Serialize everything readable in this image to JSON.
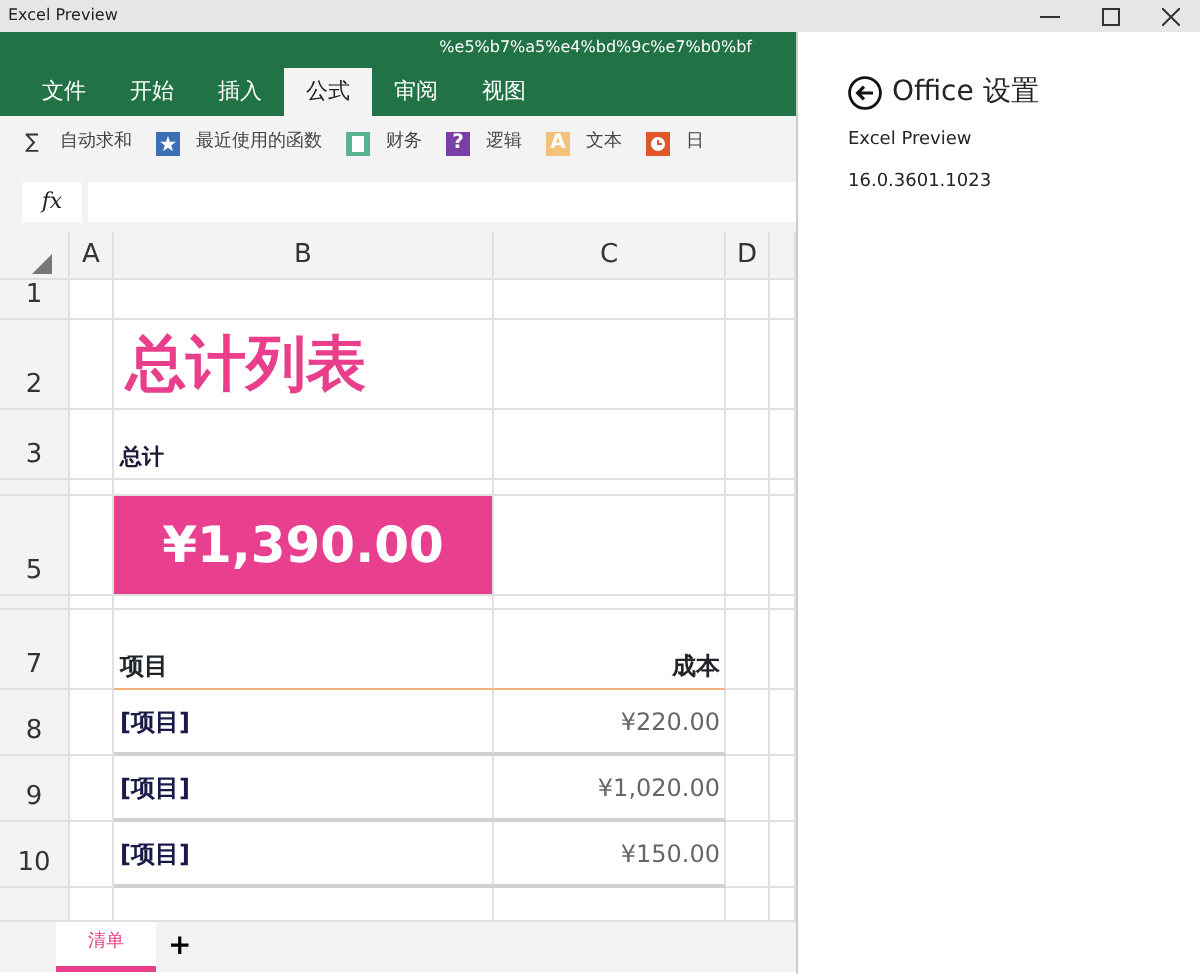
{
  "window": {
    "title": "Excel Preview"
  },
  "document_name": "%e5%b7%a5%e4%bd%9c%e7%b0%bf",
  "tabs": [
    {
      "label": "文件",
      "selected": false
    },
    {
      "label": "开始",
      "selected": false
    },
    {
      "label": "插入",
      "selected": false
    },
    {
      "label": "公式",
      "selected": true
    },
    {
      "label": "审阅",
      "selected": false
    },
    {
      "label": "视图",
      "selected": false
    }
  ],
  "ribbon": [
    {
      "label": "自动求和",
      "kind": "sum",
      "glyph": "∑"
    },
    {
      "label": "最近使用的函数",
      "kind": "star",
      "color": "#3d6fb6"
    },
    {
      "label": "财务",
      "kind": "book",
      "color": "#5ab38e"
    },
    {
      "label": "逻辑",
      "kind": "question",
      "glyph": "?",
      "color": "#7b3fa8"
    },
    {
      "label": "文本",
      "kind": "letter",
      "glyph": "A",
      "color": "#f2c27a"
    },
    {
      "label": "日",
      "kind": "clock",
      "color": "#e0572a"
    }
  ],
  "formula_bar": {
    "label": "fx"
  },
  "columns": [
    "A",
    "B",
    "C",
    "D"
  ],
  "rows": [
    {
      "header": "1",
      "kind": "blank"
    },
    {
      "header": "2",
      "kind": "title",
      "b": "总计列表"
    },
    {
      "header": "3",
      "kind": "label",
      "b": "总计"
    },
    {
      "kind": "spacer"
    },
    {
      "header": "5",
      "kind": "total",
      "b": "¥1,390.00"
    },
    {
      "kind": "spacer"
    },
    {
      "header": "7",
      "kind": "table_header",
      "b": "项目",
      "c": "成本"
    },
    {
      "header": "8",
      "kind": "item",
      "b": "[项目]",
      "c": "¥220.00"
    },
    {
      "header": "9",
      "kind": "item",
      "b": "[项目]",
      "c": "¥1,020.00"
    },
    {
      "header": "10",
      "kind": "item",
      "b": "[项目]",
      "c": "¥150.00"
    }
  ],
  "sheet_tabs": [
    {
      "label": "清单",
      "selected": true
    }
  ],
  "add_sheet": "+",
  "settings": {
    "title": "Office 设置",
    "app": "Excel Preview",
    "version": "16.0.3601.1023"
  }
}
